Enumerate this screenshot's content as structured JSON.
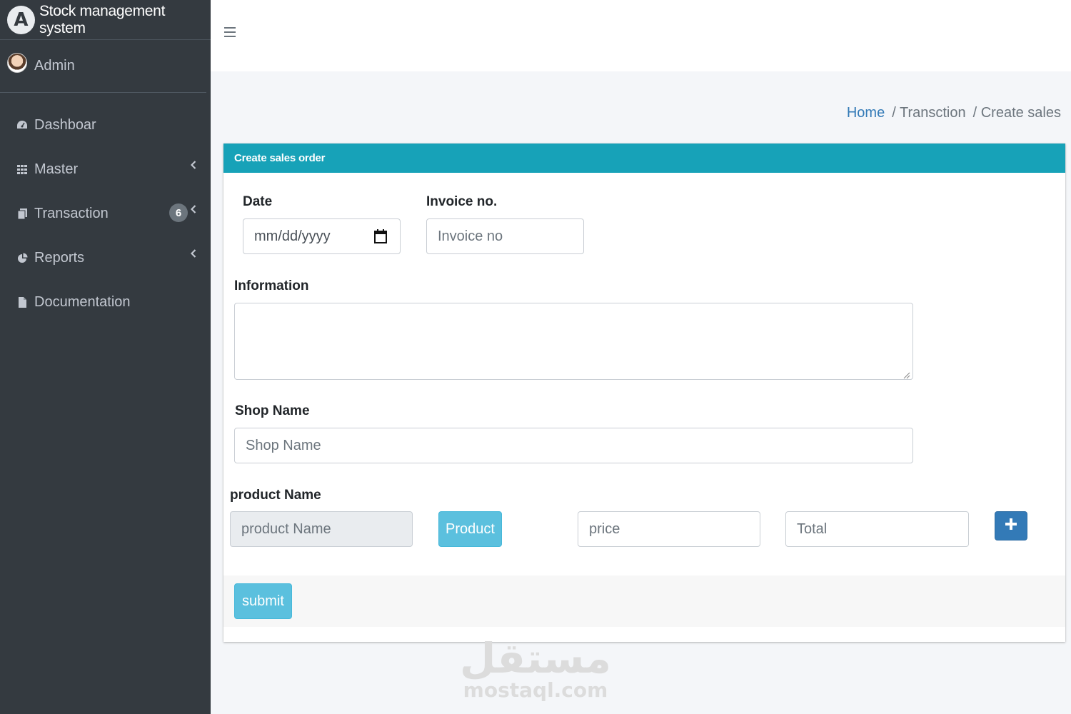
{
  "app": {
    "brand_text": "Stock management system",
    "brand_logo_letter": "A",
    "user_name": "Admin"
  },
  "sidebar": {
    "items": [
      {
        "label": "Dashboar",
        "icon": "dashboard-icon",
        "has_chevron": false
      },
      {
        "label": "Master",
        "icon": "grid-icon",
        "has_chevron": true
      },
      {
        "label": "Transaction",
        "icon": "copy-icon",
        "has_chevron": true,
        "badge": "6"
      },
      {
        "label": "Reports",
        "icon": "pie-chart-icon",
        "has_chevron": true
      },
      {
        "label": "Documentation",
        "icon": "file-icon",
        "has_chevron": false
      }
    ]
  },
  "breadcrumb": {
    "home": "Home",
    "transaction": "/ Transction",
    "current": "/ Create sales"
  },
  "form": {
    "header": "Create sales order",
    "date_label": "Date",
    "date_placeholder": "mm/dd/yyyy",
    "invoice_label": "Invoice no.",
    "invoice_placeholder": "Invoice no",
    "information_label": "Information",
    "shop_label": "Shop Name",
    "shop_placeholder": "Shop Name",
    "product_label": "product Name",
    "product_placeholder": "product Name",
    "product_button": "Product",
    "price_placeholder": "price",
    "total_placeholder": "Total",
    "add_button": "+",
    "submit_button": "submit"
  },
  "watermark": {
    "arabic": "مستقل",
    "latin": "mostaql.com"
  },
  "colors": {
    "sidebar_bg": "#343a40",
    "header_teal": "#17a2b8",
    "info_button": "#5bc0de",
    "primary_button": "#337ab7",
    "link_blue": "#337ab7"
  }
}
